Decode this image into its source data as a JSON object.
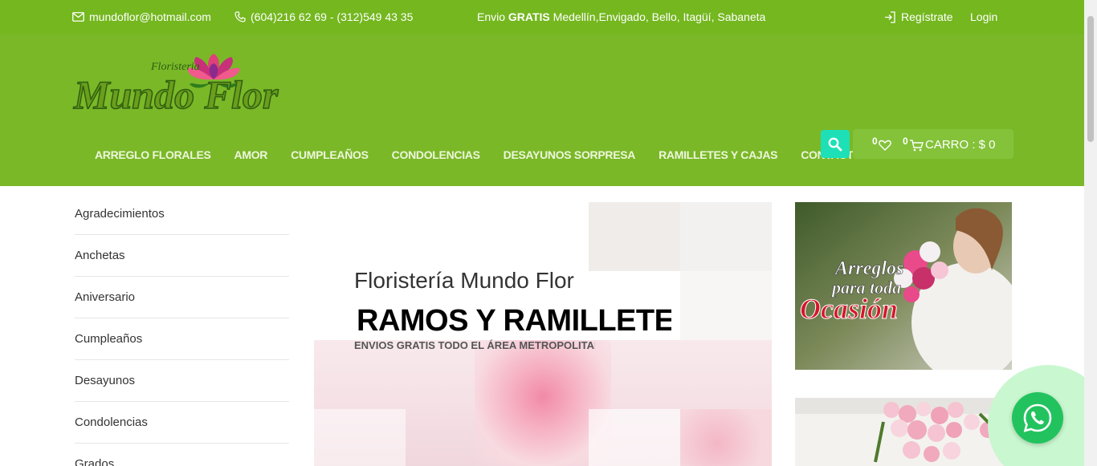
{
  "topbar": {
    "email": "mundoflor@hotmail.com",
    "phones": "(604)216 62 69 - (312)549 43 35",
    "promo_prefix": "Envio ",
    "promo_bold": "GRATIS",
    "promo_suffix": " Medellín,Envigado, Bello, Itagüí, Sabaneta",
    "register": "Regístrate",
    "login": "Login"
  },
  "logo": {
    "small_text": "Floristeria",
    "main_text": "Mundo Flor"
  },
  "nav": [
    {
      "label": "ARREGLO FLORALES"
    },
    {
      "label": "AMOR"
    },
    {
      "label": "CUMPLEAÑOS"
    },
    {
      "label": "CONDOLENCIAS"
    },
    {
      "label": "DESAYUNOS SORPRESA"
    },
    {
      "label": "RAMILLETES Y CAJAS"
    },
    {
      "label": "CONTACTO"
    }
  ],
  "cart": {
    "wishlist_count": "0",
    "cart_count": "0",
    "label": "CARRO : $ 0"
  },
  "sidebar": {
    "categories": [
      "Agradecimientos",
      "Anchetas",
      "Aniversario",
      "Cumpleaños",
      "Desayunos",
      "Condolencias",
      "Grados"
    ]
  },
  "hero": {
    "line1": "Floristería Mundo Flor",
    "line2": "RAMOS Y RAMILLETES",
    "line3": "ENVIOS GRATIS TODO EL ÁREA METROPOLITANA"
  },
  "promo": {
    "line1": "Arreglos",
    "line2": "para toda",
    "line3": "Ocasión"
  },
  "colors": {
    "topbar": "#74b71f",
    "header": "#7ab828",
    "search": "#1de0b7",
    "whatsapp": "#22c35e"
  }
}
